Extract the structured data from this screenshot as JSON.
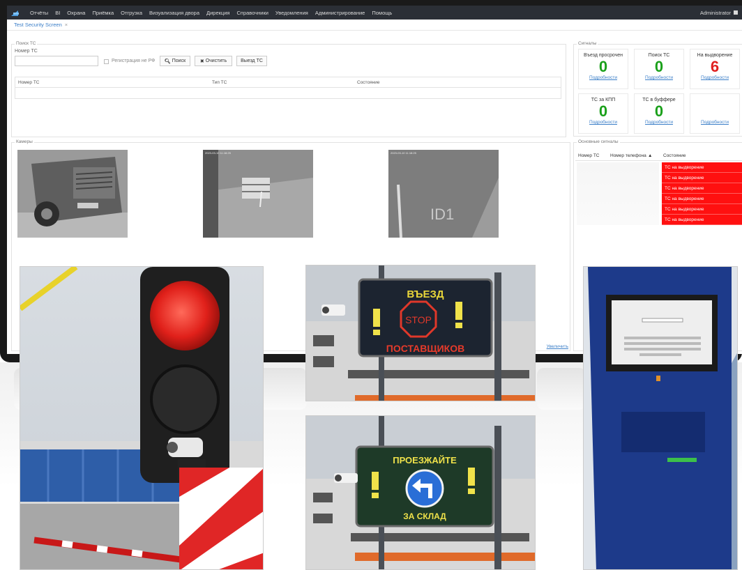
{
  "nav": {
    "items": [
      "Отчёты",
      "BI",
      "Охрана",
      "Приёмка",
      "Отгрузка",
      "Визуализация двора",
      "Дирекция",
      "Справочники",
      "Уведомления",
      "Администрирование",
      "Помощь"
    ],
    "user": "Administrator"
  },
  "breadcrumb": {
    "label": "Test Security Screen",
    "close": "×"
  },
  "search": {
    "panel_title": "Поиск ТС",
    "field_label": "Номер ТС",
    "field_value": "",
    "checkbox_label": "Регистрация не РФ",
    "search_button": "Поиск",
    "clear_button": "Очистить",
    "exit_button": "Выезд ТС",
    "columns": [
      "Номер ТС",
      "Тип ТС",
      "Состояние"
    ]
  },
  "signals": {
    "panel_title": "Сигналы",
    "cards": [
      {
        "title": "Въезд просрочен",
        "value": "0",
        "link": "Подробности",
        "color": "green"
      },
      {
        "title": "Поиск ТС",
        "value": "0",
        "link": "Подробности",
        "color": "green"
      },
      {
        "title": "На выдворение",
        "value": "6",
        "link": "Подробности",
        "color": "red"
      },
      {
        "title": "ТС за КПП",
        "value": "0",
        "link": "Подробности",
        "color": "green"
      },
      {
        "title": "ТС в буффере",
        "value": "0",
        "link": "Подробности",
        "color": "green"
      },
      {
        "title": "",
        "value": "",
        "link": "Подробности",
        "color": "green"
      }
    ]
  },
  "cameras": {
    "panel_title": "Камеры",
    "zoom_link": "Увеличить",
    "timestamps": [
      "",
      "2023-03-10 11:18:25",
      "2023-03-10 11:18:25"
    ]
  },
  "main_signals": {
    "panel_title": "Основные сигналы",
    "columns": [
      "Номер ТС",
      "Номер телефона",
      "Состояние"
    ],
    "sort_marker": "▲",
    "rows": [
      "ТС на выдворение",
      "ТС на выдворение",
      "ТС на выдворение",
      "ТС на выдворение",
      "ТС на выдворение",
      "ТС на выдворение"
    ]
  },
  "signs": {
    "entry_top": "ВЪЕЗД",
    "entry_bottom": "ПОСТАВЩИКОВ",
    "stop": "STOP",
    "drive_top": "ПРОЕЗЖАЙТЕ",
    "drive_bottom": "ЗА СКЛАД"
  },
  "colors": {
    "nav_bg": "#2b2f36",
    "link": "#3a7ec8",
    "ok": "#1aa01a",
    "alert": "#e02020",
    "row_alert": "#ff1010"
  }
}
